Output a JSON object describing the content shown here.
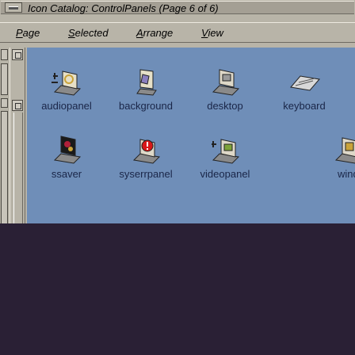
{
  "window": {
    "title": "Icon Catalog: ControlPanels (Page 6 of 6)"
  },
  "menubar": {
    "items": [
      {
        "mnemonic": "P",
        "rest": "age"
      },
      {
        "mnemonic": "S",
        "rest": "elected"
      },
      {
        "mnemonic": "A",
        "rest": "rrange"
      },
      {
        "mnemonic": "V",
        "rest": "iew"
      }
    ]
  },
  "icons": [
    {
      "label": "audiopanel",
      "icon": "audiopanel-icon",
      "color": "#c9a33a"
    },
    {
      "label": "background",
      "icon": "background-icon",
      "color": "#8a7fbf"
    },
    {
      "label": "desktop",
      "icon": "desktop-icon",
      "color": "#9a9a9a"
    },
    {
      "label": "keyboard",
      "icon": "keyboard-icon",
      "color": "#d8d8d8"
    },
    {
      "label": "ssaver",
      "icon": "ssaver-icon",
      "color": "#b0203a"
    },
    {
      "label": "syserrpanel",
      "icon": "syserrpanel-icon",
      "color": "#d81818"
    },
    {
      "label": "videopanel",
      "icon": "videopanel-icon",
      "color": "#7da23a"
    },
    {
      "label": "wind",
      "icon": "window-icon",
      "color": "#c9a33a"
    }
  ]
}
